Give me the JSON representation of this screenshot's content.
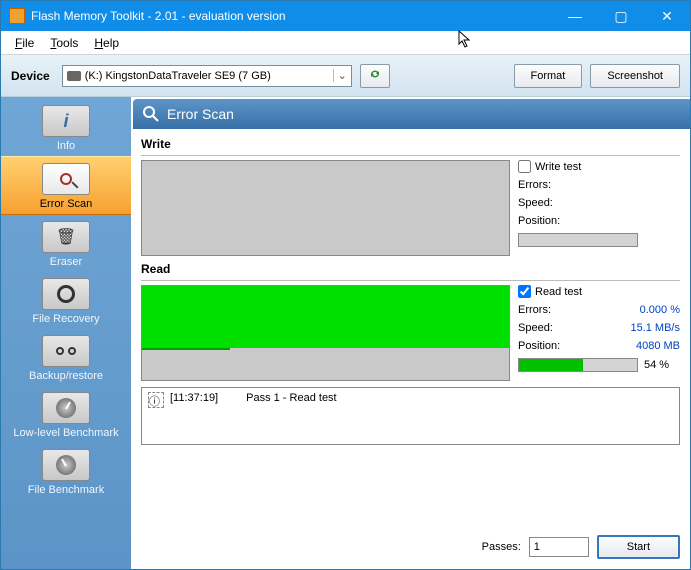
{
  "title": "Flash Memory Toolkit - 2.01 - evaluation version",
  "menu": {
    "file": "File",
    "tools": "Tools",
    "help": "Help"
  },
  "devicebar": {
    "label": "Device",
    "selected": "(K:) KingstonDataTraveler SE9 (7 GB)",
    "format": "Format",
    "screenshot": "Screenshot"
  },
  "sidebar": {
    "items": [
      {
        "label": "Info"
      },
      {
        "label": "Error Scan"
      },
      {
        "label": "Eraser"
      },
      {
        "label": "File Recovery"
      },
      {
        "label": "Backup/restore"
      },
      {
        "label": "Low-level Benchmark"
      },
      {
        "label": "File Benchmark"
      }
    ]
  },
  "header": {
    "title": "Error Scan"
  },
  "write": {
    "title": "Write",
    "checkbox": "Write test",
    "errors_label": "Errors:",
    "speed_label": "Speed:",
    "position_label": "Position:"
  },
  "read": {
    "title": "Read",
    "checkbox": "Read test",
    "errors_label": "Errors:",
    "errors_value": "0.000 %",
    "speed_label": "Speed:",
    "speed_value": "15.1 MB/s",
    "position_label": "Position:",
    "position_value": "4080 MB",
    "progress_pct": "54 %",
    "progress_fill": 54
  },
  "log": {
    "time": "[11:37:19]",
    "text": "Pass 1 - Read test"
  },
  "footer": {
    "passes_label": "Passes:",
    "passes_value": "1",
    "start": "Start"
  }
}
